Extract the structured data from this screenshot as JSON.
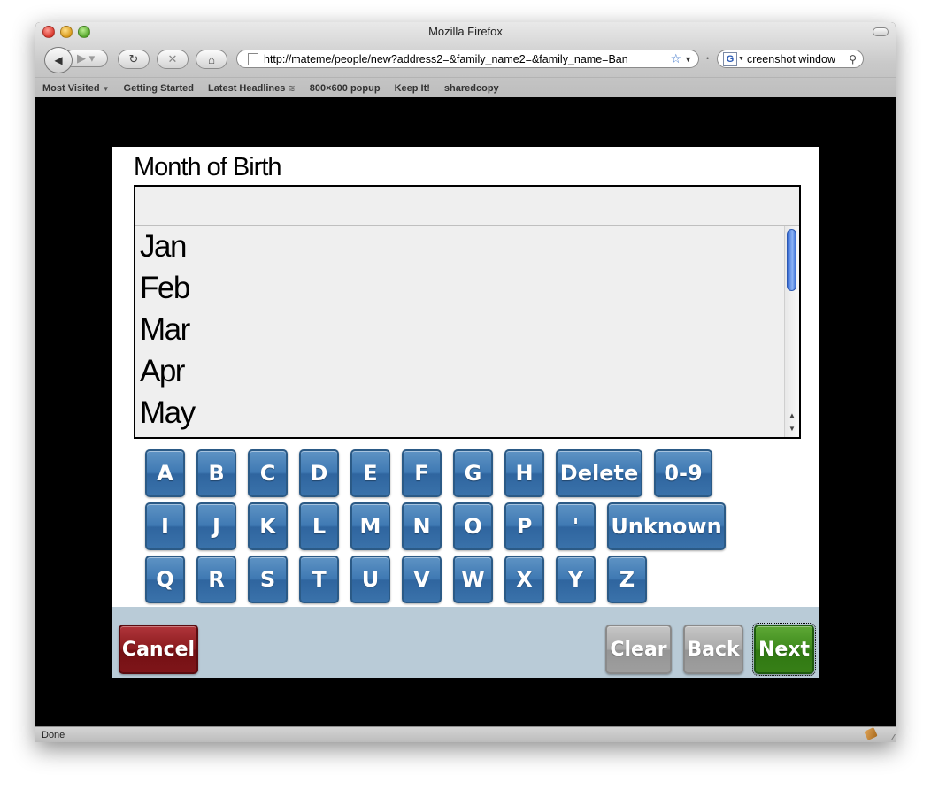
{
  "window": {
    "title": "Mozilla Firefox"
  },
  "navbar": {
    "back_glyph": "◀",
    "forward_glyph": "▶ ▾",
    "reload_glyph": "↻",
    "stop_glyph": "✕",
    "home_glyph": "⌂",
    "url": "http://mateme/people/new?address2=&family_name2=&family_name=Ban",
    "search_value": "creenshot window",
    "search_engine_glyph": "G"
  },
  "bookmarks": [
    {
      "label": "Most Visited"
    },
    {
      "label": "Getting Started"
    },
    {
      "label": "Latest Headlines"
    },
    {
      "label": "800×600 popup"
    },
    {
      "label": "Keep It!"
    },
    {
      "label": "sharedcopy"
    }
  ],
  "status": {
    "text": "Done"
  },
  "form": {
    "label": "Month of Birth",
    "input_value": "",
    "options": [
      "Jan",
      "Feb",
      "Mar",
      "Apr",
      "May"
    ]
  },
  "keyboard": {
    "row1": [
      "A",
      "B",
      "C",
      "D",
      "E",
      "F",
      "G",
      "H"
    ],
    "row1_extra": [
      "Delete",
      "0-9"
    ],
    "row2": [
      "I",
      "J",
      "K",
      "L",
      "M",
      "N",
      "O",
      "P",
      "'"
    ],
    "row2_extra": [
      "Unknown"
    ],
    "row3": [
      "Q",
      "R",
      "S",
      "T",
      "U",
      "V",
      "W",
      "X",
      "Y",
      "Z"
    ]
  },
  "actions": {
    "cancel": "Cancel",
    "clear": "Clear",
    "back": "Back",
    "next": "Next"
  },
  "colors": {
    "key_blue": "#3f79b3",
    "cancel_red": "#8a1a1e",
    "next_green": "#3d8a1c",
    "neutral_gray": "#a9a9a9",
    "button_bar": "#b9cbd7"
  }
}
